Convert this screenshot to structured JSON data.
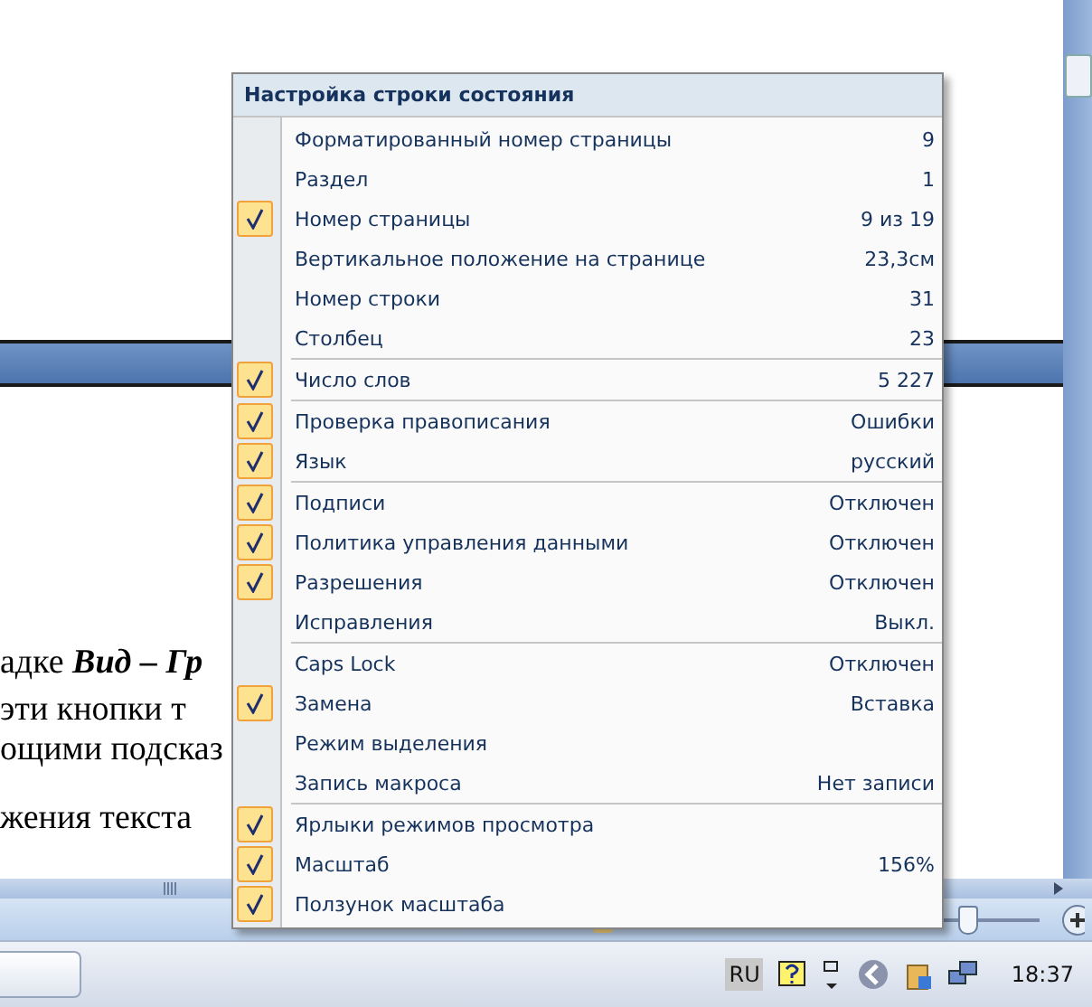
{
  "document": {
    "lines": [
      "адке **Вид – Гр**",
      "эти кнопки т",
      "ощими подсказ",
      "жения текста"
    ]
  },
  "zoom_slider": {
    "level": 0.55
  },
  "menu": {
    "title": "Настройка строки состояния",
    "groups": [
      {
        "items": [
          {
            "label": "Форматированный номер страницы",
            "value": "9",
            "checked": false
          },
          {
            "label": "Раздел",
            "value": "1",
            "checked": false
          },
          {
            "label": "Номер страницы",
            "value": "9 из 19",
            "checked": true
          },
          {
            "label": "Вертикальное положение на странице",
            "value": "23,3см",
            "checked": false
          },
          {
            "label": "Номер строки",
            "value": "31",
            "checked": false
          },
          {
            "label": "Столбец",
            "value": "23",
            "checked": false
          }
        ]
      },
      {
        "items": [
          {
            "label": "Число слов",
            "value": "5 227",
            "checked": true
          }
        ]
      },
      {
        "items": [
          {
            "label": "Проверка правописания",
            "value": "Ошибки",
            "checked": true
          },
          {
            "label": "Язык",
            "value": "русский",
            "checked": true
          }
        ]
      },
      {
        "items": [
          {
            "label": "Подписи",
            "value": "Отключен",
            "checked": true
          },
          {
            "label": "Политика управления данными",
            "value": "Отключен",
            "checked": true
          },
          {
            "label": "Разрешения",
            "value": "Отключен",
            "checked": true
          },
          {
            "label": "Исправления",
            "value": "Выкл.",
            "checked": false
          }
        ]
      },
      {
        "items": [
          {
            "label": "Caps Lock",
            "value": "Отключен",
            "checked": false
          },
          {
            "label": "Замена",
            "value": "Вставка",
            "checked": true
          },
          {
            "label": "Режим выделения",
            "checked": false
          },
          {
            "label": "Запись макроса",
            "value": "Нет записи",
            "checked": false
          }
        ]
      },
      {
        "items": [
          {
            "label": "Ярлыки режимов просмотра",
            "checked": true
          },
          {
            "label": "Масштаб",
            "value": "156%",
            "checked": true
          },
          {
            "label": "Ползунок масштаба",
            "checked": true
          }
        ]
      }
    ]
  },
  "taskbar": {
    "language": "RU",
    "clock": "18:37"
  }
}
